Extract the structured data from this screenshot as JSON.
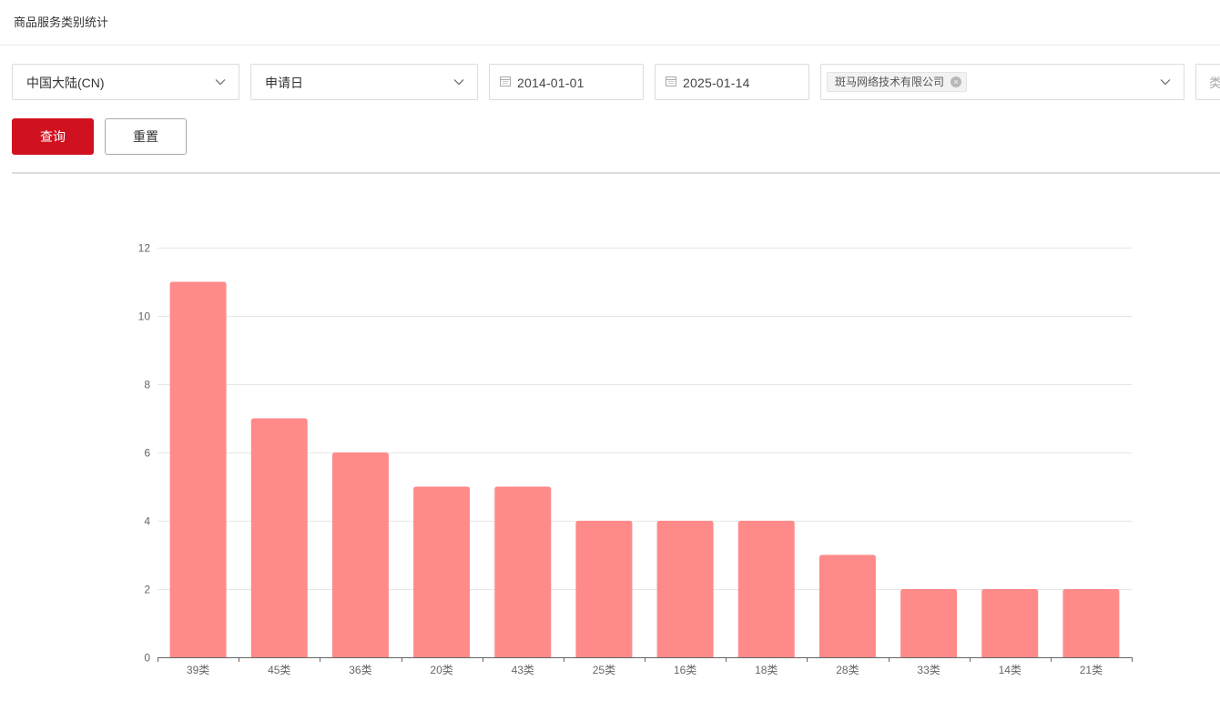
{
  "header": {
    "title": "商品服务类别统计"
  },
  "filters": {
    "region": {
      "value": "中国大陆(CN)"
    },
    "date_type": {
      "value": "申请日"
    },
    "start_date": {
      "value": "2014-01-01"
    },
    "end_date": {
      "value": "2025-01-14"
    },
    "applicant": {
      "tags": [
        "斑马网络技术有限公司"
      ]
    },
    "category_partial": {
      "value": "类"
    }
  },
  "actions": {
    "search_label": "查询",
    "reset_label": "重置"
  },
  "colors": {
    "primary": "#d0111f",
    "bar": "#ff8a8a",
    "grid": "#e6e6e6",
    "axis": "#666666"
  },
  "chart_data": {
    "type": "bar",
    "categories": [
      "39类",
      "45类",
      "36类",
      "20类",
      "43类",
      "25类",
      "16类",
      "18类",
      "28类",
      "33类",
      "14类",
      "21类"
    ],
    "values": [
      11,
      7,
      6,
      5,
      5,
      4,
      4,
      4,
      3,
      2,
      2,
      2
    ],
    "ylim": [
      0,
      12
    ],
    "yticks": [
      0,
      2,
      4,
      6,
      8,
      10,
      12
    ],
    "grid": true,
    "title": "",
    "xlabel": "",
    "ylabel": ""
  }
}
